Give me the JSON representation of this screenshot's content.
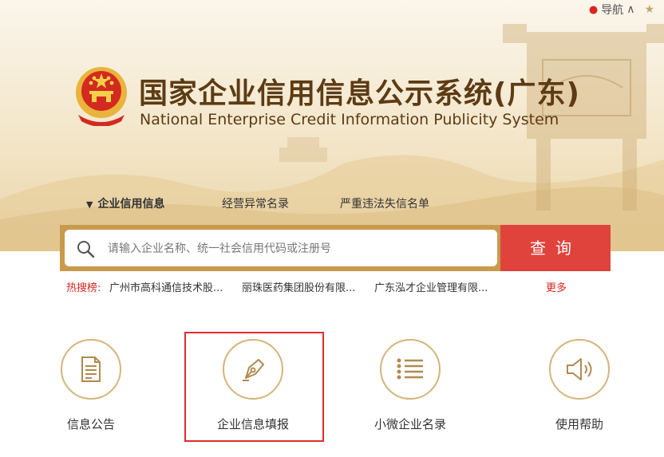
{
  "header": {
    "nav_label": "导航",
    "title": "国家企业信用信息公示系统(广东)",
    "subtitle": "National Enterprise Credit Information Publicity System"
  },
  "tabs": [
    {
      "label": "企业信用信息",
      "active": true
    },
    {
      "label": "经营异常名录",
      "active": false
    },
    {
      "label": "严重违法失信名单",
      "active": false
    }
  ],
  "search": {
    "placeholder": "请输入企业名称、统一社会信用代码或注册号",
    "value": "",
    "button_label": "查询"
  },
  "hot_search": {
    "label": "热搜榜:",
    "items": [
      "广州市高科通信技术股...",
      "丽珠医药集团股份有限...",
      "广东泓才企业管理有限..."
    ],
    "more_label": "更多"
  },
  "services": [
    {
      "label": "信息公告",
      "icon": "document-icon"
    },
    {
      "label": "企业信息填报",
      "icon": "pen-icon",
      "highlighted": true
    },
    {
      "label": "小微企业名录",
      "icon": "list-icon"
    },
    {
      "label": "使用帮助",
      "icon": "speaker-icon"
    }
  ],
  "colors": {
    "accent_red": "#e0433c",
    "gold": "#c89a4e",
    "title_brown": "#5d3b14",
    "highlight_red": "#e32b2b"
  }
}
